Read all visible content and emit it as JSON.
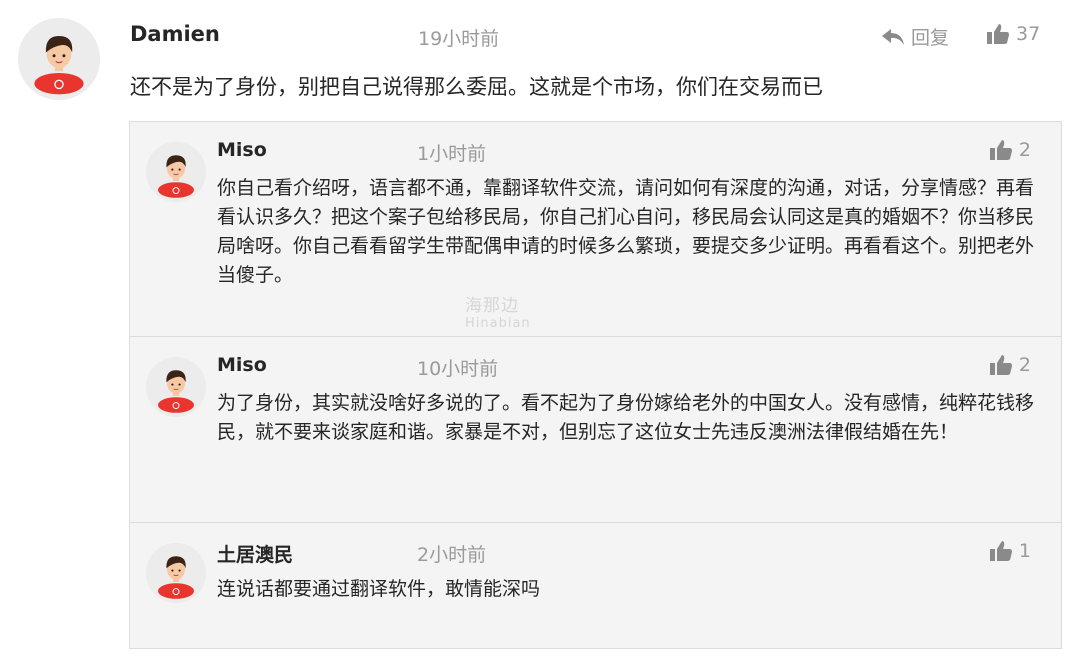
{
  "main_comment": {
    "author": "Damien",
    "time": "19小时前",
    "reply_label": "回复",
    "likes": "37",
    "text": "还不是为了身份，别把自己说得那么委屈。这就是个市场，你们在交易而已"
  },
  "replies": [
    {
      "author": "Miso",
      "time": "1小时前",
      "likes": "2",
      "text": "你自己看介绍呀，语言都不通，靠翻译软件交流，请问如何有深度的沟通，对话，分享情感？再看看认识多久？把这个案子包给移民局，你自己扪心自问，移民局会认同这是真的婚姻不？你当移民局啥呀。你自己看看留学生带配偶申请的时候多么繁琐，要提交多少证明。再看看这个。别把老外当傻子。"
    },
    {
      "author": "Miso",
      "time": "10小时前",
      "likes": "2",
      "text": "为了身份，其实就没啥好多说的了。看不起为了身份嫁给老外的中国女人。没有感情，纯粹花钱移民，就不要来谈家庭和谐。家暴是不对，但别忘了这位女士先违反澳洲法律假结婚在先！"
    },
    {
      "author": "土居澳民",
      "time": "2小时前",
      "likes": "1",
      "text": "连说话都要通过翻译软件，敢情能深吗"
    }
  ],
  "watermark": {
    "line1": "海那边",
    "line2": "Hinabian"
  },
  "colors": {
    "avatar_bg": "#ececec",
    "shirt": "#e8352e",
    "hair": "#3a2418",
    "skin": "#f6c9a2",
    "meta_gray": "#9a9a9a",
    "reply_bg": "#f4f4f4"
  },
  "icons": {
    "reply": "reply-arrow-icon",
    "like": "thumbs-up-icon"
  }
}
